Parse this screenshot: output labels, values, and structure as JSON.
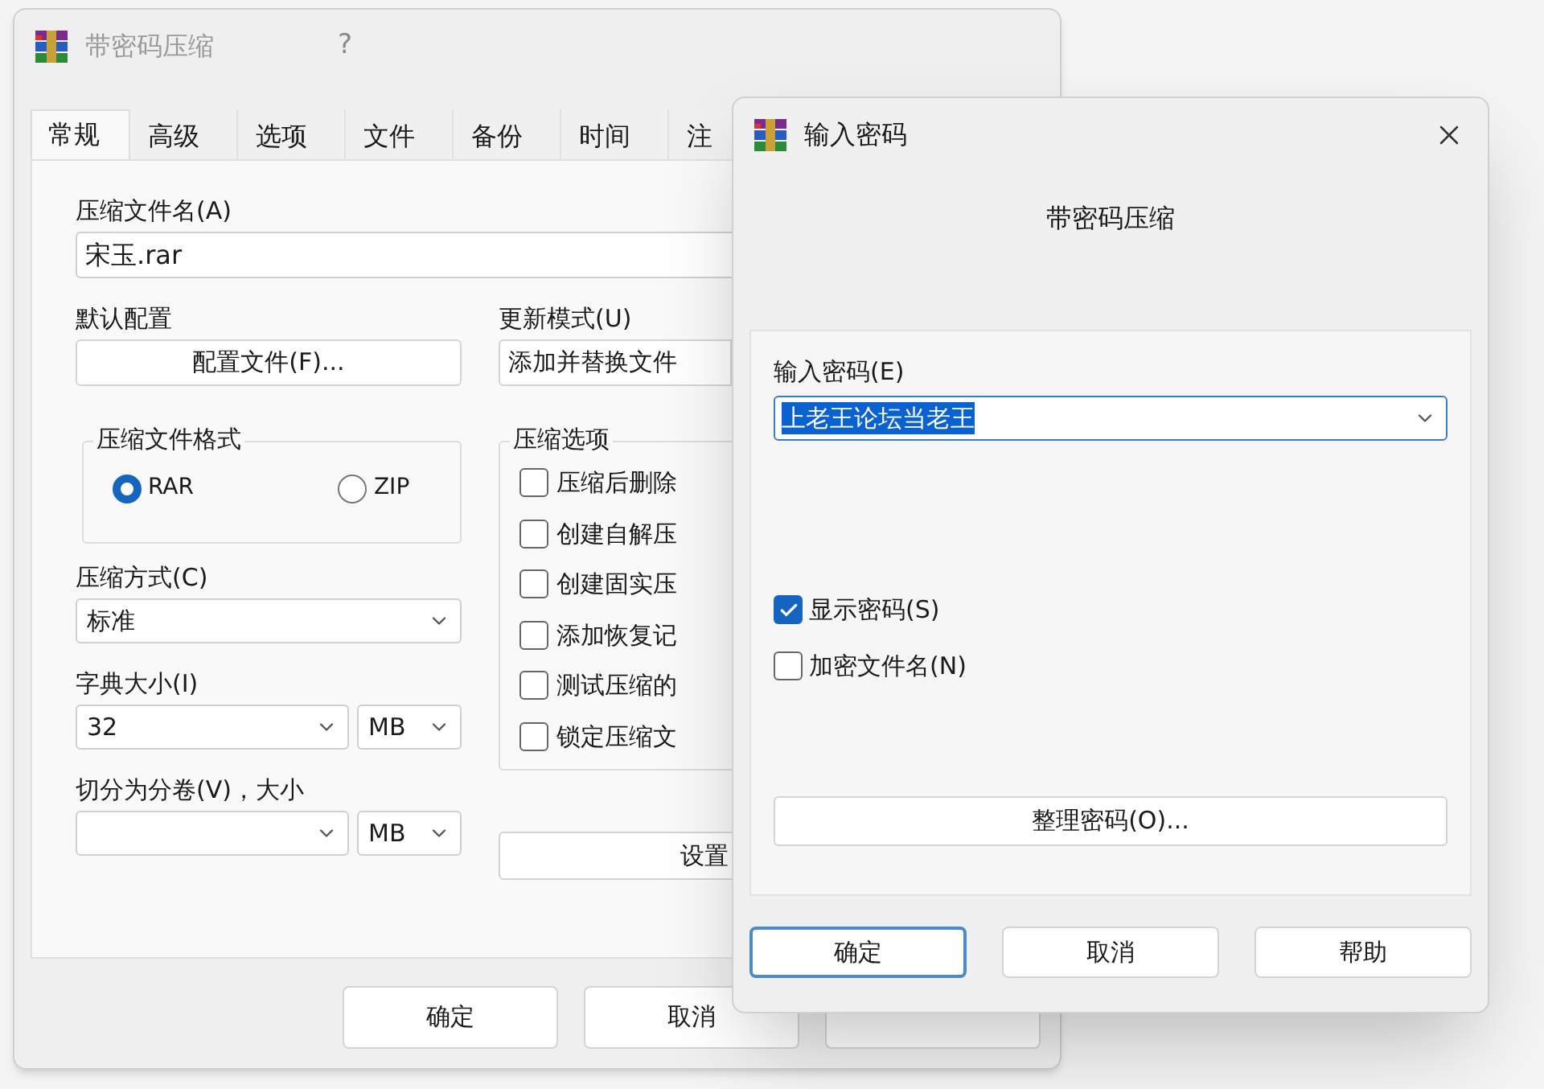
{
  "archive_window": {
    "title": "带密码压缩",
    "help_glyph": "?",
    "tabs": [
      {
        "label": "常规",
        "selected": true
      },
      {
        "label": "高级",
        "selected": false
      },
      {
        "label": "选项",
        "selected": false
      },
      {
        "label": "文件",
        "selected": false
      },
      {
        "label": "备份",
        "selected": false
      },
      {
        "label": "时间",
        "selected": false
      },
      {
        "label": "注",
        "selected": false
      }
    ],
    "archive_name": {
      "label": "压缩文件名(A)",
      "value": "宋玉.rar"
    },
    "profile": {
      "label": "默认配置",
      "button": "配置文件(F)..."
    },
    "update_mode": {
      "label": "更新模式(U)",
      "value": "添加并替换文件"
    },
    "format": {
      "label": "压缩文件格式",
      "options": [
        {
          "label": "RAR",
          "selected": true
        },
        {
          "label": "ZIP",
          "selected": false
        }
      ]
    },
    "method": {
      "label": "压缩方式(C)",
      "value": "标准"
    },
    "dictionary": {
      "label": "字典大小(I)",
      "value": "32",
      "unit": "MB"
    },
    "split": {
      "label": "切分为分卷(V)，大小",
      "unit": "MB"
    },
    "options": {
      "label": "压缩选项",
      "items": [
        {
          "label": "压缩后删除",
          "checked": false
        },
        {
          "label": "创建自解压",
          "checked": false
        },
        {
          "label": "创建固实压",
          "checked": false
        },
        {
          "label": "添加恢复记",
          "checked": false
        },
        {
          "label": "测试压缩的",
          "checked": false
        },
        {
          "label": "锁定压缩文",
          "checked": false
        }
      ]
    },
    "set_button": "设置",
    "buttons": [
      "确定",
      "取消"
    ]
  },
  "password_dialog": {
    "title": "输入密码",
    "heading": "带密码压缩",
    "password": {
      "label": "输入密码(E)",
      "value": "上老王论坛当老王"
    },
    "checks": [
      {
        "label": "显示密码(S)",
        "checked": true
      },
      {
        "label": "加密文件名(N)",
        "checked": false
      }
    ],
    "organize_button": "整理密码(O)...",
    "buttons": [
      {
        "label": "确定",
        "focused": true
      },
      {
        "label": "取消",
        "focused": false
      },
      {
        "label": "帮助",
        "focused": false
      }
    ]
  }
}
